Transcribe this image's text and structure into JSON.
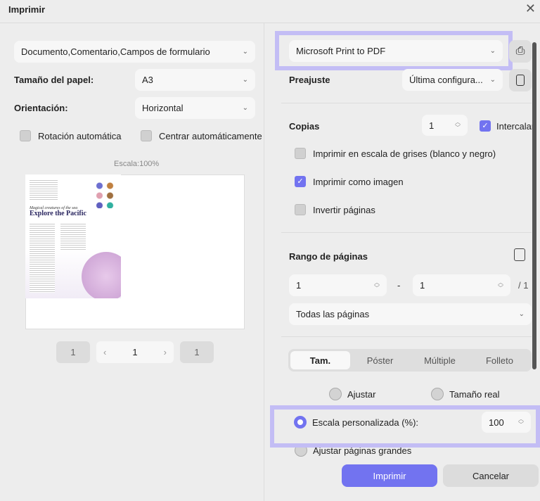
{
  "dialog": {
    "title": "Imprimir",
    "close": "✕"
  },
  "left": {
    "content_select": "Documento,Comentario,Campos de formulario",
    "paper_size_label": "Tamaño del papel:",
    "paper_size": "A3",
    "orientation_label": "Orientación:",
    "orientation": "Horizontal",
    "auto_rotate": {
      "label": "Rotación automática",
      "checked": false
    },
    "auto_center": {
      "label": "Centrar automáticamente",
      "checked": false
    },
    "scale_text": "Escala:100%",
    "preview": {
      "subtitle": "Magical creatures of the sea",
      "title": "Explore the Pacific"
    },
    "pager": {
      "first": "1",
      "current": "1",
      "last": "1",
      "prev": "‹",
      "next": "›"
    }
  },
  "right": {
    "printer": "Microsoft Print to PDF",
    "preset_label": "Preajuste",
    "preset": "Última configura...",
    "copies_label": "Copias",
    "copies": "1",
    "collate": {
      "label": "Intercalar",
      "checked": true
    },
    "grayscale": {
      "label": "Imprimir en escala de grises (blanco y negro)",
      "checked": false
    },
    "as_image": {
      "label": "Imprimir como imagen",
      "checked": true
    },
    "reverse": {
      "label": "Invertir páginas",
      "checked": false
    },
    "range_label": "Rango de páginas",
    "range_from": "1",
    "range_sep": "-",
    "range_to": "1",
    "range_total": "/ 1",
    "range_select": "Todas las páginas",
    "tabs": [
      "Tam.",
      "Póster",
      "Múltiple",
      "Folleto"
    ],
    "fit": "Ajustar",
    "actual": "Tamaño real",
    "custom_scale": "Escala personalizada (%):",
    "custom_scale_value": "100",
    "shrink": "Ajustar páginas grandes",
    "print": "Imprimir",
    "cancel": "Cancelar"
  },
  "colors": {
    "accent": "#7273f0",
    "highlight": "#c3bdf5"
  }
}
